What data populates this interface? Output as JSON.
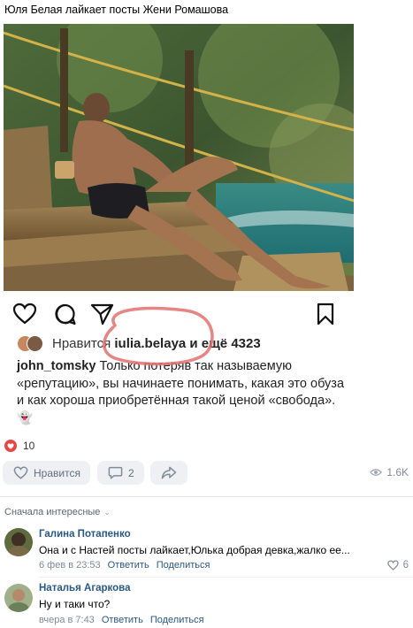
{
  "post": {
    "text": "Юля Белая лайкает посты Жени Ромашова"
  },
  "instagram": {
    "likes_prefix": "Нравится",
    "likes_user": "iulia.belaya",
    "likes_suffix": "и ещё 4323",
    "caption_user": "john_tomsky",
    "caption_text": "Только потеряв так называемую «репутацию», вы начинаете понимать, какая это обуза и как хороша приобретённая такой ценой «свобода».",
    "caption_emoji": "👻",
    "icons": [
      "heart-icon",
      "comment-icon",
      "share-icon",
      "bookmark-icon"
    ]
  },
  "footer": {
    "likes_count": "10",
    "like_label": "Нравится",
    "comments_count": "2",
    "views": "1.6K"
  },
  "comments": {
    "sort_label": "Сначала интересные",
    "items": [
      {
        "name": "Галина Потапенко",
        "text": "Она и с Настей посты лайкает,Юлька добрая девка,жалко ее...",
        "date": "6 фев в 23:53",
        "reply": "Ответить",
        "share": "Поделиться",
        "likes": "6"
      },
      {
        "name": "Наталья Агаркова",
        "text": "Ну и таки что?",
        "date": "вчера в 7:43",
        "reply": "Ответить",
        "share": "Поделиться"
      }
    ]
  },
  "colors": {
    "vk_link": "#2a5885",
    "like_red": "#e64646",
    "annotation_red": "#e0706f",
    "button_bg": "#eef0f3"
  }
}
